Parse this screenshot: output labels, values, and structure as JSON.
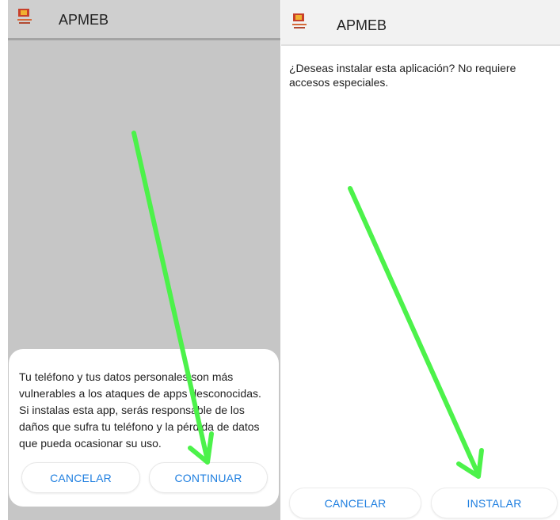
{
  "left_screen": {
    "app_bar": {
      "title": "APMEB",
      "icon": "app-logo-icon"
    },
    "dialog": {
      "message": "Tu teléfono y tus datos personales son más vulnerables a los ataques de apps desconoci­das. Si instalas esta app, serás responsable de los daños que sufra tu teléfono y la pérdida de datos que pueda ocasionar su uso.",
      "cancel_label": "CANCELAR",
      "continue_label": "CONTINUAR"
    }
  },
  "right_screen": {
    "app_bar": {
      "title": "APMEB",
      "icon": "app-logo-icon"
    },
    "question": "¿Deseas instalar esta aplicación? No requiere accesos especiales.",
    "cancel_label": "CANCELAR",
    "install_label": "INSTALAR"
  },
  "annotations": {
    "arrow_color": "#4cf24a",
    "arrow_icon": "green-arrow-icon"
  },
  "colors": {
    "button_text": "#1f7fe0",
    "dim_background": "#c6c6c6"
  }
}
